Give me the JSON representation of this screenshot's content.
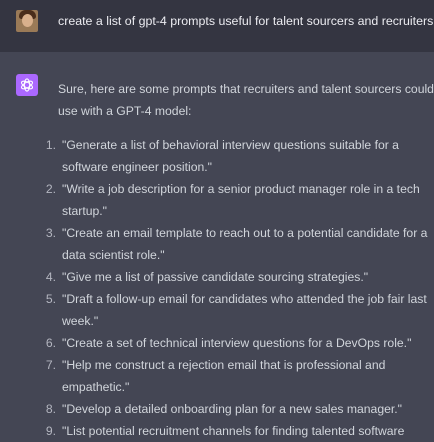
{
  "user_message": {
    "text": "create a list of gpt-4 prompts useful for talent sourcers and recruiters"
  },
  "assistant_message": {
    "intro_lines": [
      "Sure, here are some prompts that recruiters and talent sourcers could",
      "use with a GPT-4 model:"
    ],
    "items": [
      {
        "num": "1.",
        "lines": [
          "\"Generate a list of behavioral interview questions suitable for a",
          "software engineer position.\""
        ]
      },
      {
        "num": "2.",
        "lines": [
          "\"Write a job description for a senior product manager role in a tech",
          "startup.\""
        ]
      },
      {
        "num": "3.",
        "lines": [
          "\"Create an email template to reach out to a potential candidate for a",
          "data scientist role.\""
        ]
      },
      {
        "num": "4.",
        "lines": [
          "\"Give me a list of passive candidate sourcing strategies.\""
        ]
      },
      {
        "num": "5.",
        "lines": [
          "\"Draft a follow-up email for candidates who attended the job fair last",
          "week.\""
        ]
      },
      {
        "num": "6.",
        "lines": [
          "\"Create a set of technical interview questions for a DevOps role.\""
        ]
      },
      {
        "num": "7.",
        "lines": [
          "\"Help me construct a rejection email that is professional and",
          "empathetic.\""
        ]
      },
      {
        "num": "8.",
        "lines": [
          "\"Develop a detailed onboarding plan for a new sales manager.\""
        ]
      },
      {
        "num": "9.",
        "lines": [
          "\"List potential recruitment channels for finding talented software"
        ]
      }
    ]
  },
  "colors": {
    "user_bg": "#343541",
    "assistant_bg": "#444654",
    "assistant_avatar": "#ab68ff",
    "text": "#d1d5db"
  },
  "icons": {
    "user_avatar": "user-photo-avatar",
    "assistant_avatar": "openai-logo-icon"
  }
}
